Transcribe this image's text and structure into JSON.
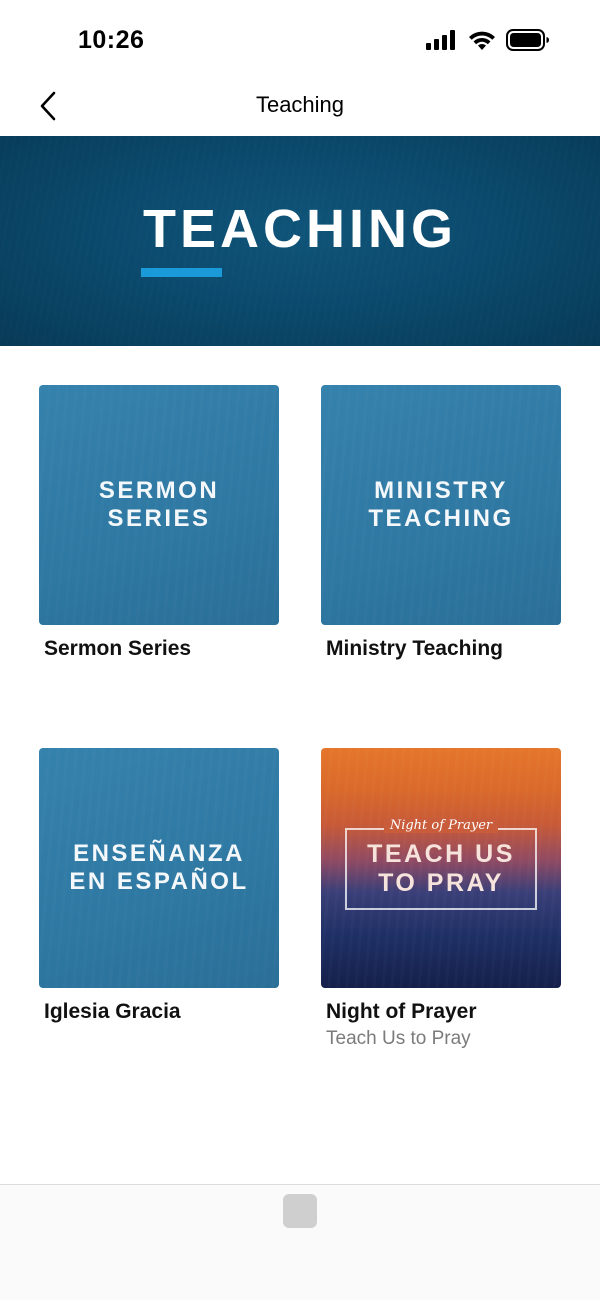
{
  "status_bar": {
    "time": "10:26",
    "icons": [
      "cellular-signal-icon",
      "wifi-icon",
      "battery-icon"
    ]
  },
  "nav": {
    "back_icon": "chevron-left-icon",
    "title": "Teaching"
  },
  "hero": {
    "title": "TEACHING",
    "accent_color": "#1b9ad9",
    "background_color": "#0b4a6d"
  },
  "tiles": [
    {
      "art_text": "SERMON\nSERIES",
      "title": "Sermon Series",
      "subtitle": ""
    },
    {
      "art_text": "MINISTRY\nTEACHING",
      "title": "Ministry Teaching",
      "subtitle": ""
    },
    {
      "art_text": "ENSEÑANZA\nEN ESPAÑOL",
      "title": "Iglesia Gracia",
      "subtitle": ""
    },
    {
      "art_script": "Night of Prayer",
      "art_text": "TEACH US\nTO PRAY",
      "title": "Night of Prayer",
      "subtitle": "Teach Us to Pray"
    }
  ],
  "colors": {
    "tile_blue": "#2e78a2",
    "subtitle_gray": "#7b7b7b"
  }
}
